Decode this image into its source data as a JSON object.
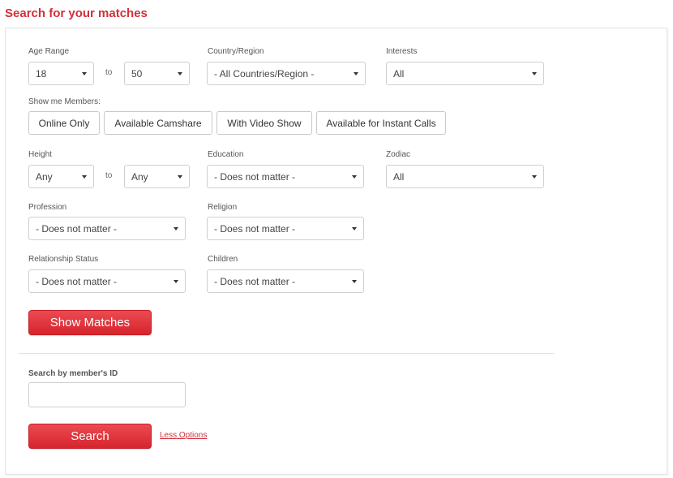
{
  "page": {
    "title": "Search for your matches",
    "accent_color": "#d22f3a"
  },
  "filters": {
    "age_range": {
      "label": "Age Range",
      "from": "18",
      "to": "50",
      "separator": "to"
    },
    "country": {
      "label": "Country/Region",
      "value": "- All Countries/Region -"
    },
    "interests": {
      "label": "Interests",
      "value": "All"
    },
    "show_members": {
      "label": "Show me Members:",
      "options": [
        "Online Only",
        "Available Camshare",
        "With Video Show",
        "Available for Instant Calls"
      ]
    },
    "height": {
      "label": "Height",
      "from": "Any",
      "to": "Any",
      "separator": "to"
    },
    "education": {
      "label": "Education",
      "value": "- Does not matter -"
    },
    "zodiac": {
      "label": "Zodiac",
      "value": "All"
    },
    "profession": {
      "label": "Profession",
      "value": "- Does not matter -"
    },
    "religion": {
      "label": "Religion",
      "value": "- Does not matter -"
    },
    "relationship_status": {
      "label": "Relationship Status",
      "value": "- Does not matter -"
    },
    "children": {
      "label": "Children",
      "value": "- Does not matter -"
    }
  },
  "actions": {
    "show_matches_label": "Show Matches"
  },
  "member_search": {
    "label": "Search by member's ID",
    "value": "",
    "placeholder": "",
    "search_label": "Search",
    "less_options_label": "Less Options"
  }
}
